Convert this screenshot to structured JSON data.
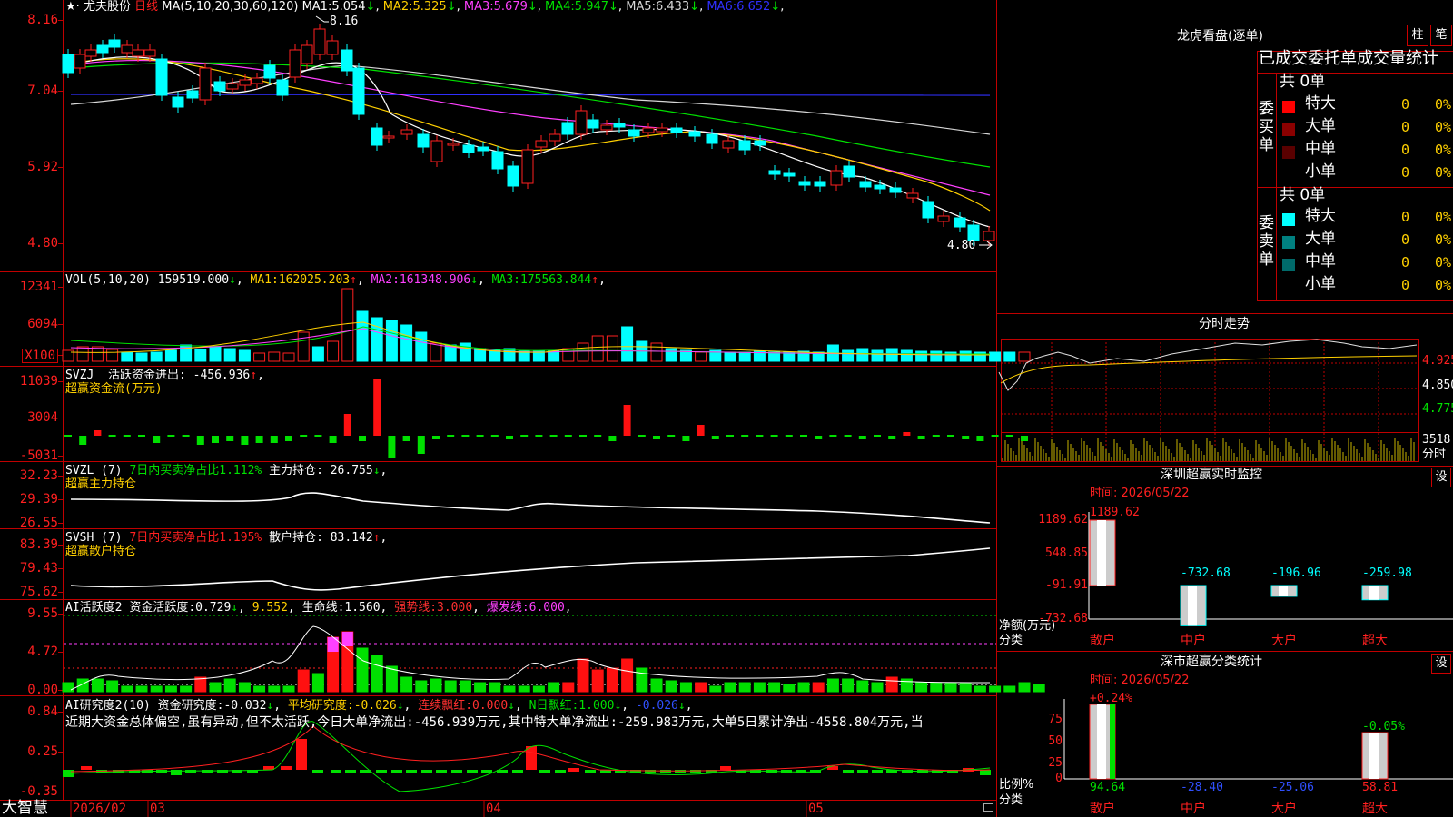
{
  "header": {
    "star": "★",
    "sep": "·",
    "stock_name": "尤夫股份",
    "period": "日线",
    "ma_title": "MA(5,10,20,30,60,120)",
    "ma_items": [
      {
        "label": "MA1:",
        "value": "5.054",
        "arrow": "↓",
        "color": "#ffffff"
      },
      {
        "label": "MA2:",
        "value": "5.325",
        "arrow": "↓",
        "color": "#ffd000"
      },
      {
        "label": "MA3:",
        "value": "5.679",
        "arrow": "↓",
        "color": "#ff40ff"
      },
      {
        "label": "MA4:",
        "value": "5.947",
        "arrow": "↓",
        "color": "#00e000"
      },
      {
        "label": "MA5:",
        "value": "6.433",
        "arrow": "↓",
        "color": "#d8d8d8"
      },
      {
        "label": "MA6:",
        "value": "6.652",
        "arrow": "↓",
        "color": "#3030ff"
      }
    ]
  },
  "axes": {
    "price": [
      "8.16",
      "7.04",
      "5.92",
      "4.80"
    ],
    "vol": [
      "12341",
      "6094",
      "X100"
    ],
    "svzj": [
      "11039",
      "3004",
      "-5031"
    ],
    "svzl": [
      "32.23",
      "29.39",
      "26.55"
    ],
    "svsh": [
      "83.39",
      "79.43",
      "75.62"
    ],
    "ai": [
      "9.55",
      "4.72",
      "0.00"
    ],
    "ai2": [
      "0.84",
      "0.25",
      "-0.35"
    ]
  },
  "price_marks": {
    "high": "8.16",
    "low": "4.80"
  },
  "vol_panel": {
    "title": "VOL(5,10,20)",
    "value": "159519.000",
    "arrow": "↓",
    "mas": [
      {
        "label": "MA1:",
        "value": "162025.203",
        "arrow": "↑",
        "color": "#ffd000"
      },
      {
        "label": "MA2:",
        "value": "161348.906",
        "arrow": "↓",
        "color": "#ff40ff"
      },
      {
        "label": "MA3:",
        "value": "175563.844",
        "arrow": "↑",
        "color": "#00e000"
      }
    ]
  },
  "svzj_panel": {
    "title": "SVZJ",
    "line1": "活跃资金进出:",
    "value": "-456.936",
    "arrow": "↑",
    "tail": ",",
    "subtitle": "超赢资金流(万元)"
  },
  "svzl_panel": {
    "title": "SVZL (7)",
    "desc": "7日内买卖净占比1.112%",
    "label": "主力持仓:",
    "value": "26.755",
    "arrow": "↓",
    "tail": ",",
    "subtitle": "超赢主力持仓"
  },
  "svsh_panel": {
    "title": "SVSH (7)",
    "desc": "7日内买卖净占比1.195%",
    "label": "散户持仓:",
    "value": "83.142",
    "arrow": "↑",
    "tail": ",",
    "subtitle": "超赢散户持仓"
  },
  "ai_panel": {
    "title": "AI活跃度2",
    "items": [
      {
        "label": "资金活跃度:",
        "value": "0.729",
        "arrow": "↓",
        "color": "#ffffff"
      },
      {
        "label": "",
        "value": "9.552",
        "arrow": "",
        "color": "#ffd000"
      },
      {
        "label": "生命线:",
        "value": "1.560",
        "arrow": "",
        "color": "#ffffff"
      },
      {
        "label": "强势线:",
        "value": "3.000",
        "arrow": "",
        "color": "#ff3030"
      },
      {
        "label": "爆发线:",
        "value": "6.000",
        "arrow": "",
        "color": "#ff40ff"
      }
    ]
  },
  "ai2_panel": {
    "title": "AI研究度2(10)",
    "items": [
      {
        "label": "资金研究度:",
        "value": "-0.032",
        "arrow": "↓",
        "color": "#ffffff"
      },
      {
        "label": "平均研究度:",
        "value": "-0.026",
        "arrow": "↓",
        "color": "#ffd000"
      },
      {
        "label": "连续飘红:",
        "value": "0.000",
        "arrow": "↓",
        "color": "#ff3030"
      },
      {
        "label": "N日飘红:",
        "value": "1.000",
        "arrow": "↓",
        "color": "#00e000"
      },
      {
        "label": "",
        "value": "-0.026",
        "arrow": "↓",
        "color": "#3050ff"
      }
    ],
    "comment": "近期大资金总体偏空,虽有异动,但不太活跃,今日大单净流出:-456.939万元,其中特大单净流出:-259.983万元,大单5日累计净出-4558.804万元,当"
  },
  "footer": {
    "brand": "大智慧",
    "dates": [
      "2026/02",
      "03",
      "04",
      "05"
    ]
  },
  "right": {
    "title": "龙虎看盘(逐单)",
    "tab_zhu": "柱",
    "tab_bi": "笔",
    "subtitle": "已成交委托单成交量统计",
    "buy_side": "委买单",
    "sell_side": "委卖单",
    "buy_total": "共 0单",
    "sell_total": "共 0单",
    "buy_rows": [
      {
        "name": "特大",
        "count": "0",
        "pct": "0%",
        "color": "#ff0000"
      },
      {
        "name": "大单",
        "count": "0",
        "pct": "0%",
        "color": "#8b0000"
      },
      {
        "name": "中单",
        "count": "0",
        "pct": "0%",
        "color": "#5a0000"
      },
      {
        "name": "小单",
        "count": "0",
        "pct": "0%",
        "color": ""
      }
    ],
    "sell_rows": [
      {
        "name": "特大",
        "count": "0",
        "pct": "0%",
        "color": "#00ffff"
      },
      {
        "name": "大单",
        "count": "0",
        "pct": "0%",
        "color": "#008080"
      },
      {
        "name": "中单",
        "count": "0",
        "pct": "0%",
        "color": "#006a6a"
      },
      {
        "name": "小单",
        "count": "0",
        "pct": "0%",
        "color": ""
      }
    ],
    "intraday": {
      "title": "分时走势",
      "prices": [
        "4.925",
        "4.850",
        "4.775"
      ],
      "vol": "3518",
      "vol_unit": "分时"
    },
    "sz_monitor": {
      "title": "深圳超赢实时监控",
      "settings": "设",
      "time_label": "时间:",
      "date": "2026/05/22",
      "axis": [
        "1189.62",
        "548.85",
        "-91.91",
        "-732.68"
      ],
      "ylabel": "净额(万元)",
      "xlabel": "分类",
      "categories": [
        "散户",
        "中户",
        "大户",
        "超大"
      ],
      "values": [
        1189.62,
        -732.68,
        -196.96,
        -259.98
      ],
      "value_labels": [
        "1189.62",
        "-732.68",
        "-196.96",
        "-259.98"
      ]
    },
    "sz_class": {
      "title": "深市超赢分类统计",
      "settings": "设",
      "time_label": "时间:",
      "date": "2026/05/22",
      "axis": [
        "75",
        "50",
        "25",
        "0"
      ],
      "ylabel": "比例%",
      "xlabel": "分类",
      "categories": [
        "散户",
        "中户",
        "大户",
        "超大"
      ],
      "values": [
        94.64,
        -28.4,
        -25.06,
        58.81
      ],
      "top_labels": [
        "+0.24%",
        "",
        "",
        "-0.05%"
      ]
    }
  }
}
